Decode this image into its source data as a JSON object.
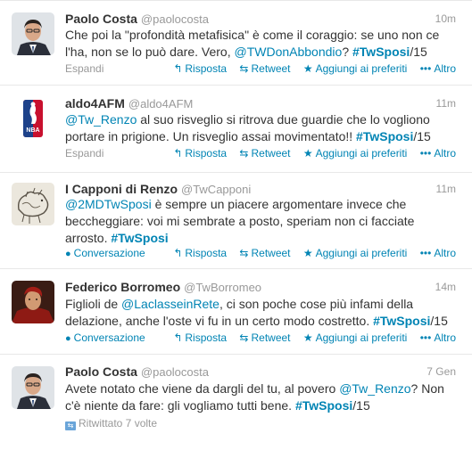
{
  "tweets": [
    {
      "fullname": "Paolo Costa",
      "username": "@paolocosta",
      "time": "10m",
      "text": [
        {
          "t": "Che poi la \"profondità metafisica\" è come il coraggio: se uno non ce l'ha, non se lo può dare. Vero, "
        },
        {
          "t": "@TWDonAbbondio",
          "k": "link"
        },
        {
          "t": "? "
        },
        {
          "t": "#TwSposi",
          "k": "hashtag"
        },
        {
          "t": "/15"
        }
      ],
      "expand": "Espandi",
      "expand_icon": "",
      "reply": "Risposta",
      "retweet": "Retweet",
      "favorite": "Aggiungi ai preferiti",
      "more": "Altro",
      "avatar": "man-suit"
    },
    {
      "fullname": "aldo4AFM",
      "username": "@aldo4AFM",
      "time": "11m",
      "text": [
        {
          "t": "@Tw_Renzo",
          "k": "link"
        },
        {
          "t": " al suo risveglio si ritrova due guardie che lo vogliono portare in prigione. Un risveglio assai movimentato!! "
        },
        {
          "t": "#TwSposi",
          "k": "hashtag"
        },
        {
          "t": "/15"
        }
      ],
      "expand": "Espandi",
      "expand_icon": "",
      "reply": "Risposta",
      "retweet": "Retweet",
      "favorite": "Aggiungi ai preferiti",
      "more": "Altro",
      "avatar": "nba-logo",
      "avatar_text": "NBA"
    },
    {
      "fullname": "I Capponi di Renzo",
      "username": "@TwCapponi",
      "time": "11m",
      "text": [
        {
          "t": "@2MDTwSposi",
          "k": "link"
        },
        {
          "t": " è sempre un piacere argomentare invece che beccheggiare: voi mi sembrate a posto, speriam non ci facciate arrosto. "
        },
        {
          "t": "#TwSposi",
          "k": "hashtag"
        }
      ],
      "expand": "Conversazione",
      "expand_icon": "conversation-icon",
      "reply": "Risposta",
      "retweet": "Retweet",
      "favorite": "Aggiungi ai preferiti",
      "more": "Altro",
      "avatar": "capons-sketch"
    },
    {
      "fullname": "Federico Borromeo",
      "username": "@TwBorromeo",
      "time": "14m",
      "text": [
        {
          "t": "Figlioli de "
        },
        {
          "t": "@LaclasseinRete",
          "k": "link"
        },
        {
          "t": ", ci son poche cose più infami della delazione, anche l'oste vi fu in un certo modo costretto. "
        },
        {
          "t": "#TwSposi",
          "k": "hashtag"
        },
        {
          "t": "/15"
        }
      ],
      "expand": "Conversazione",
      "expand_icon": "conversation-icon",
      "reply": "Risposta",
      "retweet": "Retweet",
      "favorite": "Aggiungi ai preferiti",
      "more": "Altro",
      "avatar": "cardinal-portrait"
    },
    {
      "fullname": "Paolo Costa",
      "username": "@paolocosta",
      "time": "7 Gen",
      "text": [
        {
          "t": "Avete notato che viene da dargli del tu, al povero "
        },
        {
          "t": "@Tw_Renzo",
          "k": "link"
        },
        {
          "t": "? Non c'è niente da fare: gli vogliamo tutti bene.  "
        },
        {
          "t": "#TwSposi",
          "k": "hashtag"
        },
        {
          "t": "/15"
        }
      ],
      "retweeted": "Ritwittato 7 volte",
      "avatar": "man-suit"
    }
  ],
  "colors": {
    "link": "#0084b4",
    "muted": "#999999",
    "text": "#333333",
    "border": "#e8e8e8"
  },
  "icons": {
    "reply": "reply-arrow-icon",
    "retweet": "retweet-arrows-icon",
    "favorite": "star-icon",
    "more": "ellipsis-icon"
  }
}
